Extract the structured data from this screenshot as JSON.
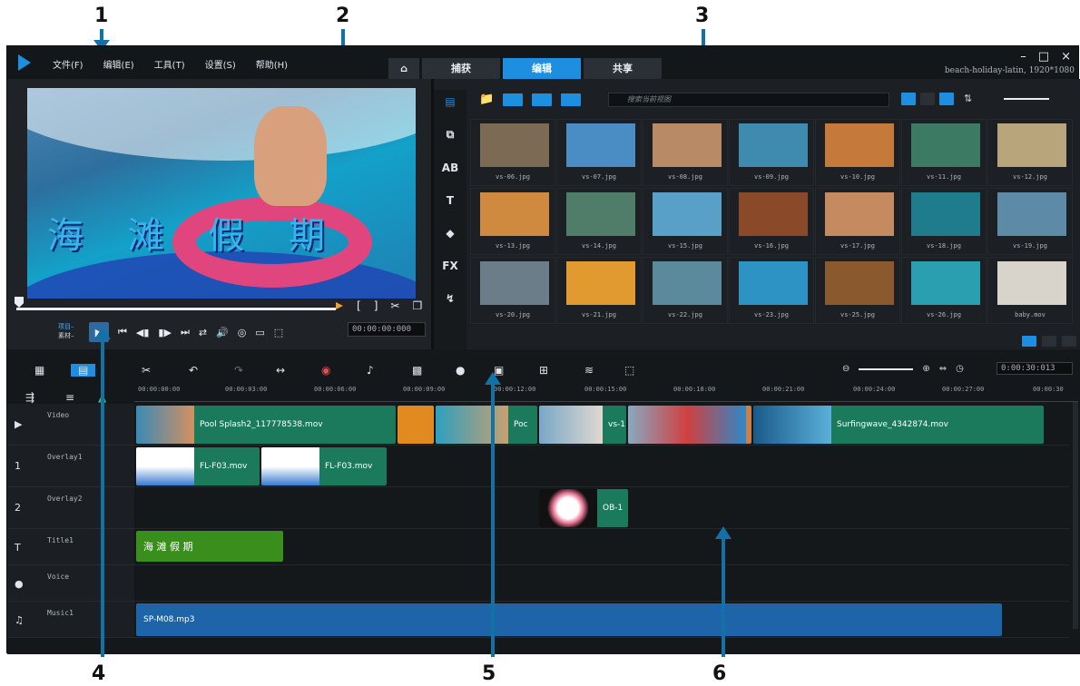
{
  "callouts": [
    "1",
    "2",
    "3",
    "4",
    "5",
    "6"
  ],
  "app": {
    "menu": [
      "文件(F)",
      "编辑(E)",
      "工具(T)",
      "设置(S)",
      "帮助(H)"
    ],
    "tabs": {
      "home": "⌂",
      "capture": "捕获",
      "edit": "编辑",
      "share": "共享"
    },
    "project_name": "beach-holiday-latin, 1920*1080",
    "window_controls": [
      "–",
      "□",
      "×"
    ]
  },
  "preview": {
    "title_overlay": "海 滩 假 期",
    "mode_labels": [
      "项目–",
      "素材–"
    ],
    "timecode": "00:00:00:000"
  },
  "library": {
    "search_placeholder": "搜索当前视图",
    "side_icons": [
      "媒体",
      "转场",
      "AB",
      "T",
      "图形",
      "FX",
      "路径"
    ],
    "thumbnails": [
      {
        "name": "vs-06.jpg",
        "color": "#7c6a55"
      },
      {
        "name": "vs-07.jpg",
        "color": "#4a8cc4"
      },
      {
        "name": "vs-08.jpg",
        "color": "#b88a66"
      },
      {
        "name": "vs-09.jpg",
        "color": "#3f8bb0"
      },
      {
        "name": "vs-10.jpg",
        "color": "#c57a3c"
      },
      {
        "name": "vs-11.jpg",
        "color": "#3c7a63"
      },
      {
        "name": "vs-12.jpg",
        "color": "#b8a57c"
      },
      {
        "name": "vs-13.jpg",
        "color": "#d08a40"
      },
      {
        "name": "vs-14.jpg",
        "color": "#4f7d6a"
      },
      {
        "name": "vs-15.jpg",
        "color": "#58a0c8"
      },
      {
        "name": "vs-16.jpg",
        "color": "#8a4a2a"
      },
      {
        "name": "vs-17.jpg",
        "color": "#c58a60"
      },
      {
        "name": "vs-18.jpg",
        "color": "#1f7c8c"
      },
      {
        "name": "vs-19.jpg",
        "color": "#5d8aa6"
      },
      {
        "name": "vs-20.jpg",
        "color": "#6c7d8a"
      },
      {
        "name": "vs-21.jpg",
        "color": "#e09a30"
      },
      {
        "name": "vs-22.jpg",
        "color": "#5a8a9c"
      },
      {
        "name": "vs-23.jpg",
        "color": "#2c93c4"
      },
      {
        "name": "vs-25.jpg",
        "color": "#8a5a2e"
      },
      {
        "name": "vs-26.jpg",
        "color": "#2a9fb0"
      },
      {
        "name": "baby.mov",
        "color": "#d8d4cc"
      }
    ]
  },
  "timeline": {
    "clock": "0:00:30:013",
    "ruler": [
      "00:00:00:00",
      "00:00:03:00",
      "00:00:06:00",
      "00:00:09:00",
      "00:00:12:00",
      "00:00:15:00",
      "00:00:18:00",
      "00:00:21:00",
      "00:00:24:00",
      "00:00:27:00",
      "00:00:30"
    ],
    "tracks": [
      {
        "name": "Video",
        "icon": "▶"
      },
      {
        "name": "Overlay1",
        "icon": "1"
      },
      {
        "name": "Overlay2",
        "icon": "2"
      },
      {
        "name": "Title1",
        "icon": "T"
      },
      {
        "name": "Voice",
        "icon": "●"
      },
      {
        "name": "Music1",
        "icon": "♫"
      }
    ],
    "clips": {
      "video1": "Pool Splash2_117778538.mov",
      "video2": "Poc",
      "video3": "vs-1",
      "video4": "Surfingwave_4342874.mov",
      "overlay1a": "FL-F03.mov",
      "overlay1b": "FL-F03.mov",
      "overlay2": "OB-1",
      "title": "海 滩 假 期",
      "music": "SP-M08.mp3"
    }
  }
}
